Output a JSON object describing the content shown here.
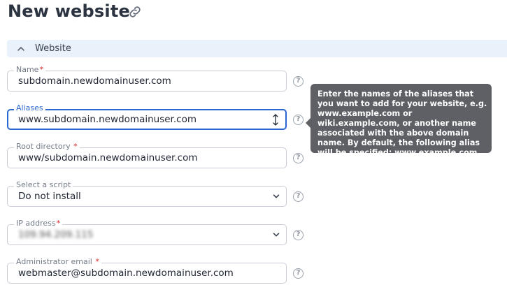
{
  "page": {
    "title": "New website"
  },
  "section": {
    "title": "Website"
  },
  "fields": {
    "name": {
      "label": "Name",
      "required_mark": "*",
      "value": "subdomain.newdomainuser.com"
    },
    "aliases": {
      "label": "Aliases",
      "value": "www.subdomain.newdomainuser.com"
    },
    "root_directory": {
      "label": "Root directory",
      "required_mark": "*",
      "value": "www/subdomain.newdomainuser.com"
    },
    "script": {
      "label": "Select a script",
      "value": "Do not install"
    },
    "ip_address": {
      "label": "IP address",
      "required_mark": "*",
      "value": "109.94.209.115"
    },
    "admin_email": {
      "label": "Administrator email",
      "required_mark": "*",
      "value": "webmaster@subdomain.newdomainuser.com"
    }
  },
  "help_glyph": "?",
  "tooltip": {
    "text": "Enter the names of the aliases that you want to add for your website, e.g. www.example.com or wiki.example.com, or another name associated with the above domain name. By default, the following alias will be specified: www.example.com"
  },
  "colors": {
    "accent": "#2b67d1",
    "required": "#d62b2b",
    "section_bg": "#e9f2fb",
    "tooltip_bg": "#5e6066"
  }
}
